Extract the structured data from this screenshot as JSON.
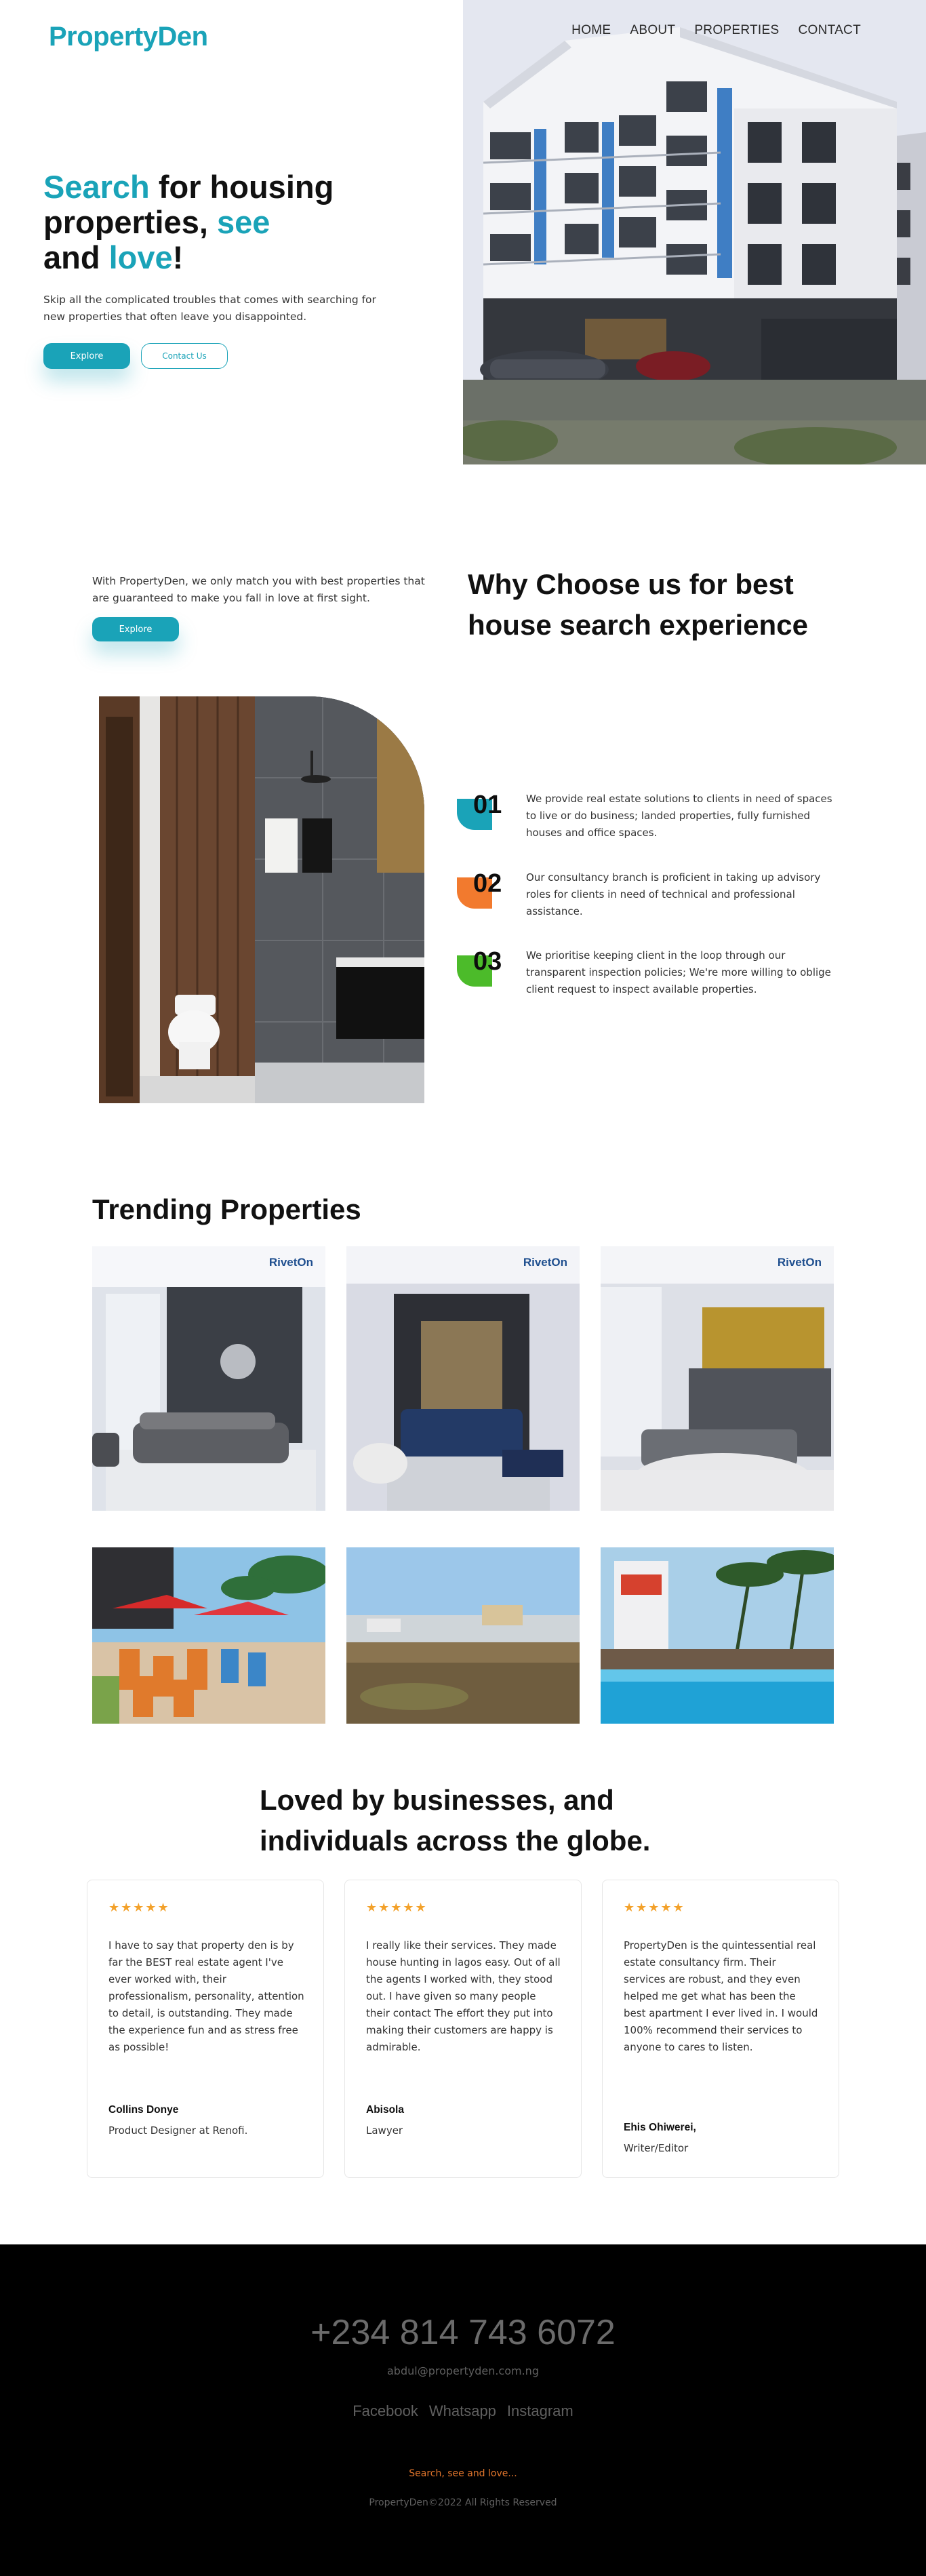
{
  "brand": {
    "logo": "PropertyDen"
  },
  "nav": {
    "items": [
      "HOME",
      "ABOUT",
      "PROPERTIES",
      "CONTACT"
    ]
  },
  "hero": {
    "title_part1": "Search",
    "title_part2": " for housing properties, ",
    "title_part3": "see",
    "title_part4": " and ",
    "title_part5": "love",
    "title_part6": "!",
    "subtitle": "Skip all the complicated troubles that comes with searching for new properties that often leave you disappointed.",
    "explore_label": "Explore",
    "contact_label": "Contact Us"
  },
  "why": {
    "intro": "With PropertyDen, we only match you with best properties that are guaranteed to make you fall in love at first sight.",
    "explore_label": "Explore",
    "title": "Why Choose us for best house search experience",
    "features": [
      {
        "num": "01",
        "text": "We provide real estate solutions to clients in need of spaces to live or do business; landed properties, fully furnished houses and office spaces.",
        "color": "#1aa3b8"
      },
      {
        "num": "02",
        "text": "Our consultancy branch is proficient in taking up advisory roles for clients in need of technical and professional assistance.",
        "color": "#f27a2e"
      },
      {
        "num": "03",
        "text": "We prioritise keeping client in the loop through our transparent inspection policies; We're more willing to oblige client request to inspect available properties.",
        "color": "#4cbb2a"
      }
    ]
  },
  "trending": {
    "title": "Trending Properties",
    "watermark": "RivetOn"
  },
  "testimonials": {
    "title": "Loved by businesses, and individuals across the globe.",
    "stars": "★★★★★",
    "items": [
      {
        "quote": "I have to say that property den is by far the BEST real estate agent I've ever worked with, their professionalism, personality, attention to detail, is outstanding. They made the experience fun and as stress free as possible!",
        "name": "Collins Donye",
        "role": "Product Designer at Renofi."
      },
      {
        "quote": "I really like their services. They made house hunting in lagos easy. Out of all the agents I worked with, they stood out. I have given so many people their contact The effort they put into making their customers are happy is admirable.",
        "name": "Abisola",
        "role": "Lawyer"
      },
      {
        "quote": "PropertyDen is the quintessential real estate consultancy firm. Their services are robust, and they even helped me get what has been the best apartment I ever lived in. I would 100% recommend their services to anyone to cares to listen.",
        "name": "Ehis Ohiwerei,",
        "role": "Writer/Editor"
      }
    ]
  },
  "footer": {
    "phone": "+234 814 743 6072",
    "email": "abdul@propertyden.com.ng",
    "socials": [
      "Facebook",
      "Whatsapp",
      "Instagram"
    ],
    "tagline": "Search, see and love...",
    "copyright": "PropertyDen©2022 All Rights Reserved"
  },
  "colors": {
    "accent": "#1aa3b8",
    "orange": "#f27a2e",
    "green": "#4cbb2a",
    "star": "#f3a12a"
  }
}
